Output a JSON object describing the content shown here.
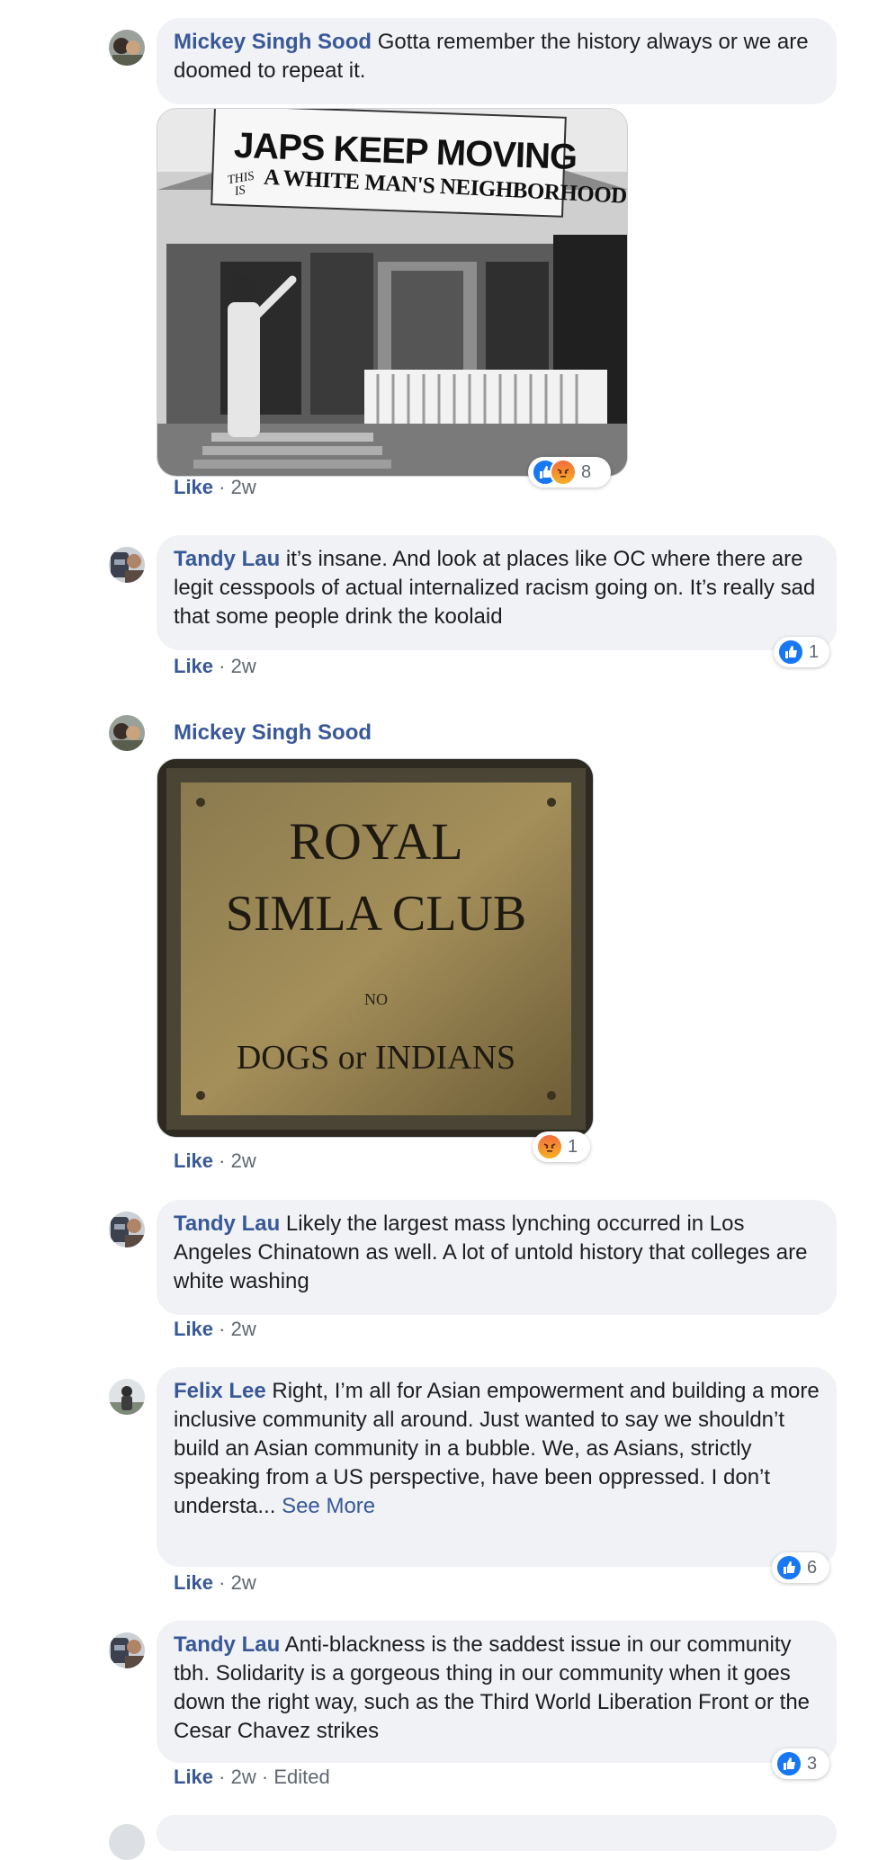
{
  "comments": [
    {
      "author": "Mickey Singh Sood",
      "text": "Gotta remember the history always or we are doomed to repeat it.",
      "like_label": "Like",
      "time": "2w",
      "photo": {
        "sign_line1": "JAPS KEEP MOVING",
        "sign_this": "THIS",
        "sign_is": "IS",
        "sign_line2": "A WHITE MAN'S NEIGHBORHOOD."
      },
      "reactions": {
        "icons": [
          "like-icon",
          "angry-icon"
        ],
        "count": "8"
      }
    },
    {
      "author": "Tandy Lau",
      "text": "it’s insane. And look at places like OC where there are legit cesspools of actual internalized racism going on. It’s really sad that some people drink the koolaid",
      "like_label": "Like",
      "time": "2w",
      "reactions": {
        "icons": [
          "like-icon"
        ],
        "count": "1"
      }
    },
    {
      "author": "Mickey Singh Sood",
      "text": "",
      "like_label": "Like",
      "time": "2w",
      "photo": {
        "plaque_line1": "ROYAL",
        "plaque_line2": "SIMLA CLUB",
        "plaque_line3": "NO",
        "plaque_line4": "DOGS or INDIANS"
      },
      "reactions": {
        "icons": [
          "angry-icon"
        ],
        "count": "1"
      }
    },
    {
      "author": "Tandy Lau",
      "text": "Likely the largest mass lynching occurred in Los Angeles Chinatown as well. A lot of untold history that colleges are white washing",
      "like_label": "Like",
      "time": "2w"
    },
    {
      "author": "Felix Lee",
      "text": "Right, I’m all for Asian empowerment and building a more inclusive community all around. Just wanted to say we shouldn’t build an Asian community in a bubble. We, as Asians, strictly speaking from a US perspective, have been oppressed. I don’t understa...",
      "see_more": "See More",
      "like_label": "Like",
      "time": "2w",
      "reactions": {
        "icons": [
          "like-icon"
        ],
        "count": "6"
      }
    },
    {
      "author": "Tandy Lau",
      "text": "Anti-blackness is the saddest issue in our community tbh. Solidarity is a gorgeous thing in our community when it goes down the right way, such as the Third World Liberation Front or the Cesar Chavez strikes",
      "like_label": "Like",
      "time": "2w",
      "edited": "Edited",
      "reactions": {
        "icons": [
          "like-icon"
        ],
        "count": "3"
      }
    }
  ],
  "separator": "·",
  "colors": {
    "link": "#385898",
    "bubble": "#f0f2f5",
    "like_blue": "#1877f2"
  }
}
